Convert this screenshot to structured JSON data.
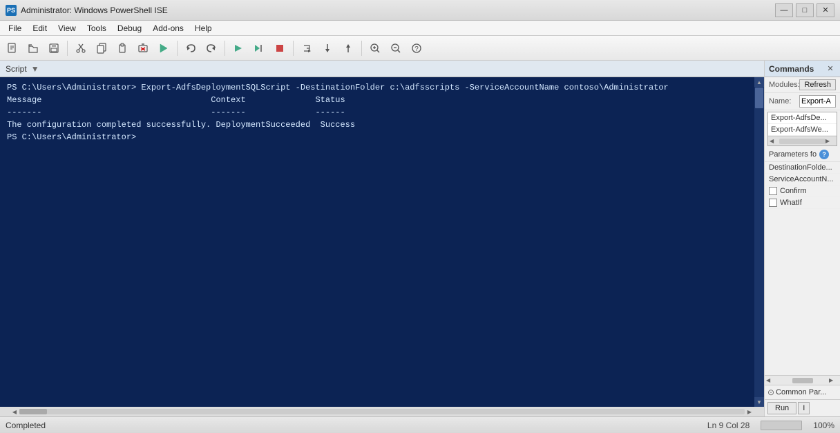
{
  "window": {
    "title": "Administrator: Windows PowerShell ISE",
    "icon_label": "PS"
  },
  "title_controls": {
    "minimize": "—",
    "maximize": "□",
    "close": "✕"
  },
  "menu": {
    "items": [
      "File",
      "Edit",
      "View",
      "Tools",
      "Debug",
      "Add-ons",
      "Help"
    ]
  },
  "toolbar": {
    "buttons": [
      {
        "name": "new",
        "icon": "📄"
      },
      {
        "name": "open",
        "icon": "📂"
      },
      {
        "name": "save",
        "icon": "💾"
      },
      {
        "name": "cut",
        "icon": "✂"
      },
      {
        "name": "copy",
        "icon": "⧉"
      },
      {
        "name": "paste",
        "icon": "📋"
      },
      {
        "name": "clear",
        "icon": "🚫"
      },
      {
        "name": "run-script",
        "icon": "▶"
      },
      {
        "name": "undo",
        "icon": "↩"
      },
      {
        "name": "redo",
        "icon": "↪"
      },
      {
        "name": "run",
        "icon": "▷"
      },
      {
        "name": "run-selection",
        "icon": "▷|"
      },
      {
        "name": "stop",
        "icon": "■"
      },
      {
        "name": "debug1",
        "icon": "⬛"
      },
      {
        "name": "debug2",
        "icon": "⬜"
      },
      {
        "name": "debug3",
        "icon": "◻"
      },
      {
        "name": "zoom-in",
        "icon": "⊕"
      },
      {
        "name": "zoom-out",
        "icon": "⊖"
      },
      {
        "name": "help",
        "icon": "❓"
      }
    ]
  },
  "script_header": {
    "label": "Script",
    "dropdown_icon": "▼"
  },
  "console": {
    "lines": [
      "PS C:\\Users\\Administrator> Export-AdfsDeploymentSQLScript -DestinationFolder c:\\adfsscripts -ServiceAccountName contoso\\Administrator",
      "",
      "Message                                  Context              Status",
      "-------                                  -------              ------",
      "The configuration completed successfully. DeploymentSucceeded  Success",
      "",
      "",
      "PS C:\\Users\\Administrator>"
    ]
  },
  "commands_panel": {
    "title": "Commands",
    "close_label": "✕",
    "modules_label": "Modules:",
    "refresh_label": "Refresh",
    "name_label": "Name:",
    "name_placeholder": "Export-A",
    "list_items": [
      "Export-AdfsDe...",
      "Export-AdfsWe..."
    ],
    "params_label": "Parameters fo",
    "params_items": [
      "DestinationFolde...",
      "ServiceAccountN..."
    ],
    "checkboxes": [
      {
        "label": "Confirm",
        "checked": false
      },
      {
        "label": "WhatIf",
        "checked": false
      }
    ],
    "common_params_label": "Common Par...",
    "run_label": "Run",
    "copy_label": "I"
  },
  "status_bar": {
    "text": "Completed",
    "position": "Ln 9  Col 28",
    "scroll_indicator": "",
    "zoom": "100%"
  }
}
